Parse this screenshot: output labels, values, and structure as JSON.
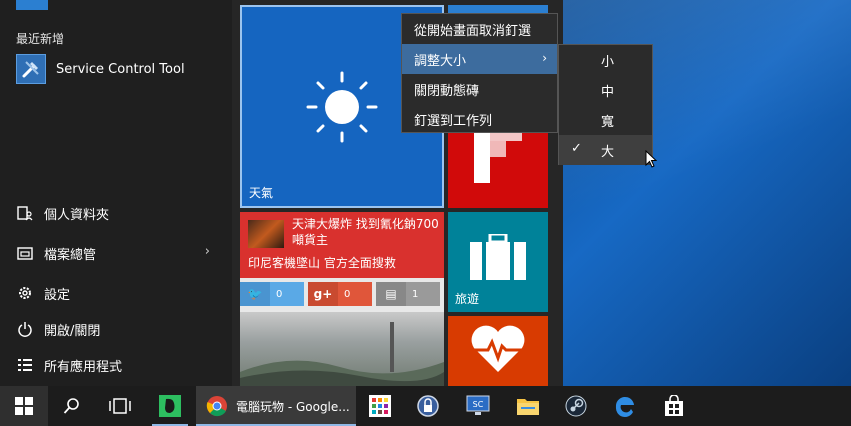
{
  "start_menu": {
    "recently_added_label": "最近新增",
    "recent_app": "Service Control Tool",
    "nav": {
      "documents": "個人資料夾",
      "file_explorer": "檔案總管",
      "settings": "設定",
      "power": "開啟/關閉",
      "all_apps": "所有應用程式"
    }
  },
  "tiles": {
    "weather_label": "天氣",
    "travel_label": "旅遊",
    "news": {
      "headline": "天津大爆炸 找到氰化鈉700噸貨主",
      "subheadline": "印尼客機墜山 官方全面搜救",
      "twitter_count": "0",
      "gplus_count": "0",
      "comment_count": "1"
    }
  },
  "context_menu": {
    "unpin": "從開始畫面取消釘選",
    "resize": "調整大小",
    "live_tile_off": "關閉動態磚",
    "pin_taskbar": "釘選到工作列"
  },
  "resize_menu": {
    "small": "小",
    "medium": "中",
    "wide": "寬",
    "large": "大"
  },
  "taskbar": {
    "chrome_title": "電腦玩物 - Google..."
  },
  "colors": {
    "accent": "#3d6c9e",
    "weather_tile": "#1565c0",
    "travel_tile": "#008299",
    "health_tile": "#d83b01",
    "news_tile": "#d9312e"
  }
}
